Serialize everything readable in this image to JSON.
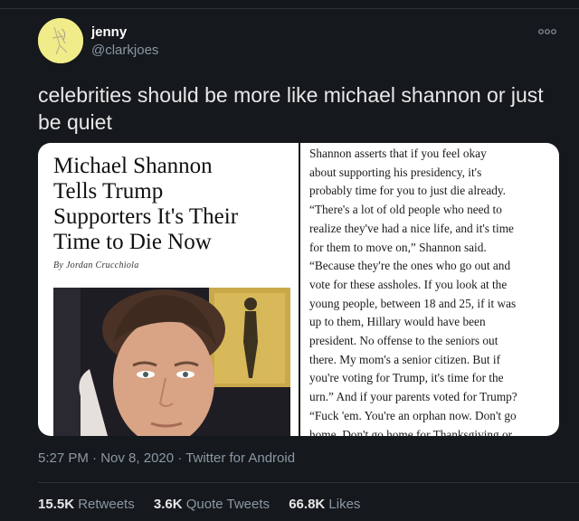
{
  "user": {
    "display_name": "jenny",
    "handle": "@clarkjoes",
    "avatar_icon": "avatar-icon",
    "avatar_bg": "#f1ec8a"
  },
  "more_icon": "more-horizontal-icon",
  "tweet_text": "celebrities should be more like michael shannon or just be quiet",
  "article": {
    "headline_lines": [
      "Michael Shannon",
      "Tells Trump",
      "Supporters It's Their",
      "Time to Die Now"
    ],
    "byline": "By Jordan Crucchiola",
    "body_lines": [
      "Shannon asserts that if you feel okay",
      "about supporting his presidency, it's",
      "probably time for you to just die already.",
      "“There's a lot of old people who need to",
      "realize they've had a nice life, and it's time",
      "for them to move on,” Shannon said.",
      "“Because they're the ones who go out and",
      "vote for these assholes. If you look at the",
      "young people, between 18 and 25, if it was",
      "up to them, Hillary would have been",
      "president. No offense to the seniors out",
      "there. My mom's a senior citizen. But if",
      "you're voting for Trump, it's time for the",
      "urn.” And if your parents voted for Trump?",
      "“Fuck 'em. You're an orphan now. Don't go",
      "home. Don't go home for Thanksgiving or"
    ]
  },
  "meta": {
    "time": "5:27 PM",
    "separator": " · ",
    "date": "Nov 8, 2020",
    "source": "Twitter for Android"
  },
  "stats": {
    "retweets_count": "15.5K",
    "retweets_label": " Retweets",
    "quote_count": "3.6K",
    "quote_label": " Quote Tweets",
    "likes_count": "66.8K",
    "likes_label": " Likes"
  }
}
